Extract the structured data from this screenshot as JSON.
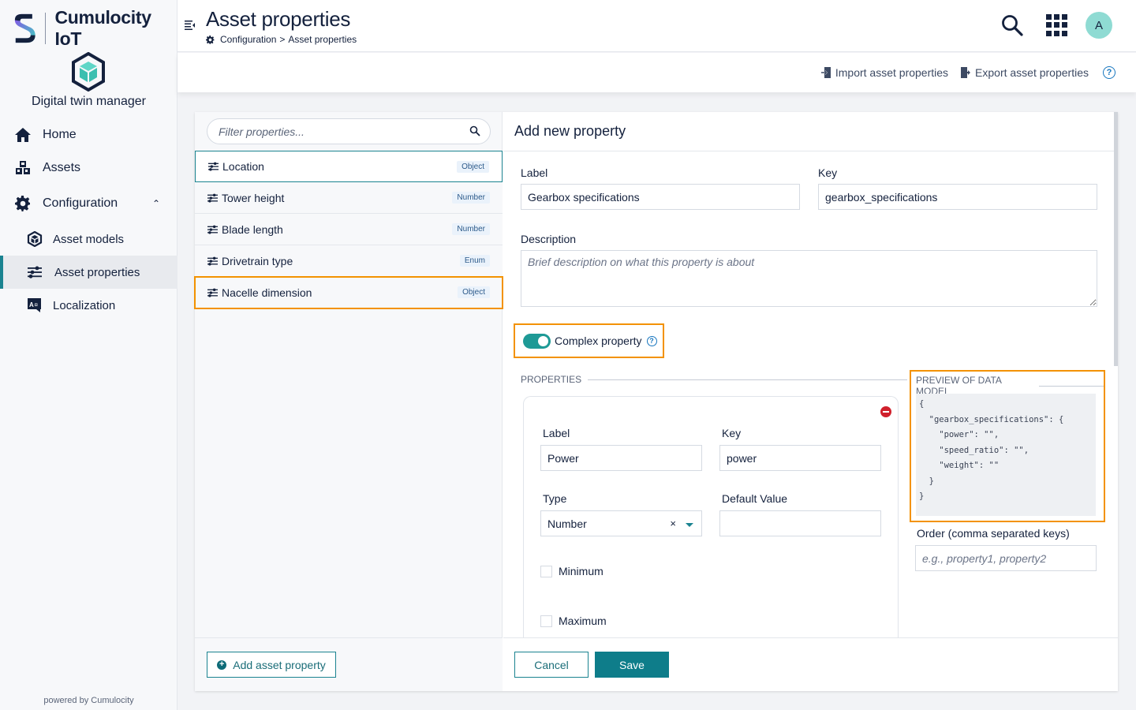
{
  "brand": {
    "name": "Cumulocity IoT",
    "app_name": "Digital twin manager",
    "powered_by": "powered by Cumulocity"
  },
  "sidebar": {
    "items": [
      {
        "label": "Home",
        "icon": "home-icon"
      },
      {
        "label": "Assets",
        "icon": "assets-icon"
      },
      {
        "label": "Configuration",
        "icon": "gear-icon",
        "expanded": true
      },
      {
        "label": "Asset models",
        "icon": "cube-icon"
      },
      {
        "label": "Asset properties",
        "icon": "sliders-icon",
        "active": true
      },
      {
        "label": "Localization",
        "icon": "translate-icon"
      }
    ]
  },
  "header": {
    "title": "Asset properties",
    "breadcrumb": [
      "Configuration",
      ">",
      "Asset properties"
    ],
    "avatar_initial": "A"
  },
  "actions": {
    "import_label": "Import asset properties",
    "export_label": "Export asset properties",
    "help": "?"
  },
  "left_pane": {
    "filter_placeholder": "Filter properties...",
    "properties": [
      {
        "label": "Location",
        "type": "Object",
        "selected": true
      },
      {
        "label": "Tower height",
        "type": "Number"
      },
      {
        "label": "Blade length",
        "type": "Number"
      },
      {
        "label": "Drivetrain type",
        "type": "Enum"
      },
      {
        "label": "Nacelle dimension",
        "type": "Object",
        "highlighted": true
      }
    ],
    "add_button": "Add asset property"
  },
  "form": {
    "title": "Add new property",
    "label_label": "Label",
    "label_value": "Gearbox specifications",
    "key_label": "Key",
    "key_value": "gearbox_specifications",
    "description_label": "Description",
    "description_placeholder": "Brief description on what this property is about",
    "complex_toggle_label": "Complex property",
    "complex_toggle_on": true,
    "properties_section": "PROPERTIES",
    "sub_property": {
      "label_label": "Label",
      "label_value": "Power",
      "key_label": "Key",
      "key_value": "power",
      "type_label": "Type",
      "type_value": "Number",
      "clear": "×",
      "default_label": "Default Value",
      "default_value": "",
      "minimum_label": "Minimum",
      "maximum_label": "Maximum"
    },
    "preview_section": "PREVIEW OF DATA MODEL",
    "preview_code": "{\n  \"gearbox_specifications\": {\n    \"power\": \"\",\n    \"speed_ratio\": \"\",\n    \"weight\": \"\"\n  }\n}",
    "order_label": "Order (comma separated keys)",
    "order_placeholder": "e.g., property1, property2",
    "cancel": "Cancel",
    "save": "Save"
  },
  "colors": {
    "accent": "#1a8390",
    "highlight": "#f39200",
    "danger": "#d0202c",
    "navy": "#14213d"
  }
}
